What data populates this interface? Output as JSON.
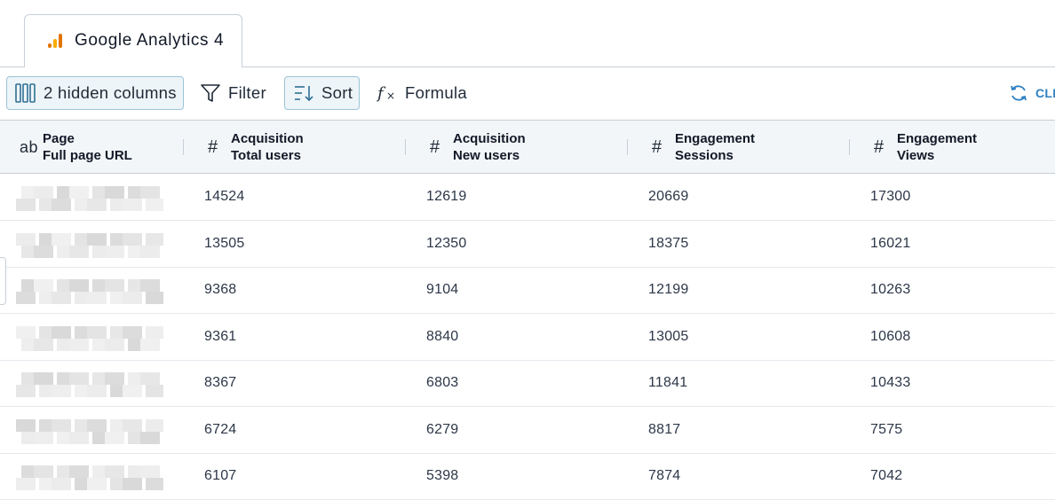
{
  "tab": {
    "label": "Google Analytics 4",
    "icon": "google-analytics-icon"
  },
  "toolbar": {
    "hidden_columns_label": "2 hidden columns",
    "filter_label": "Filter",
    "sort_label": "Sort",
    "formula_label": "Formula",
    "clear_label": "CLI"
  },
  "colors": {
    "accent": "#2f80c2",
    "ga_orange": "#f9ab00",
    "ga_dark": "#e37400",
    "header_bg": "#f3f6f8"
  },
  "table": {
    "columns": [
      {
        "type": "ab",
        "group": "Page",
        "name": "Full page URL"
      },
      {
        "type": "#",
        "group": "Acquisition",
        "name": "Total users"
      },
      {
        "type": "#",
        "group": "Acquisition",
        "name": "New users"
      },
      {
        "type": "#",
        "group": "Engagement",
        "name": "Sessions"
      },
      {
        "type": "#",
        "group": "Engagement",
        "name": "Views"
      }
    ],
    "rows": [
      [
        "",
        "14524",
        "12619",
        "20669",
        "17300"
      ],
      [
        "",
        "13505",
        "12350",
        "18375",
        "16021"
      ],
      [
        "",
        "9368",
        "9104",
        "12199",
        "10263"
      ],
      [
        "",
        "9361",
        "8840",
        "13005",
        "10608"
      ],
      [
        "",
        "8367",
        "6803",
        "11841",
        "10433"
      ],
      [
        "",
        "6724",
        "6279",
        "8817",
        "7575"
      ],
      [
        "",
        "6107",
        "5398",
        "7874",
        "7042"
      ]
    ]
  }
}
